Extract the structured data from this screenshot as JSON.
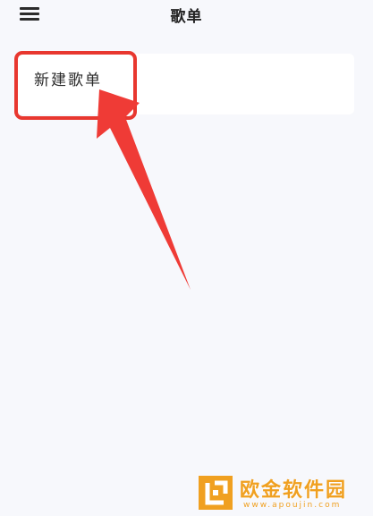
{
  "header": {
    "title": "歌单",
    "menu_icon": "hamburger-menu-icon"
  },
  "playlist_card": {
    "new_playlist_label": "新建歌单"
  },
  "annotation": {
    "highlight_color": "#e8372f",
    "arrow_color": "#e8372f"
  },
  "watermark": {
    "name": "欧金软件园",
    "url": "www.apoujin.com",
    "color": "#f0a020"
  }
}
